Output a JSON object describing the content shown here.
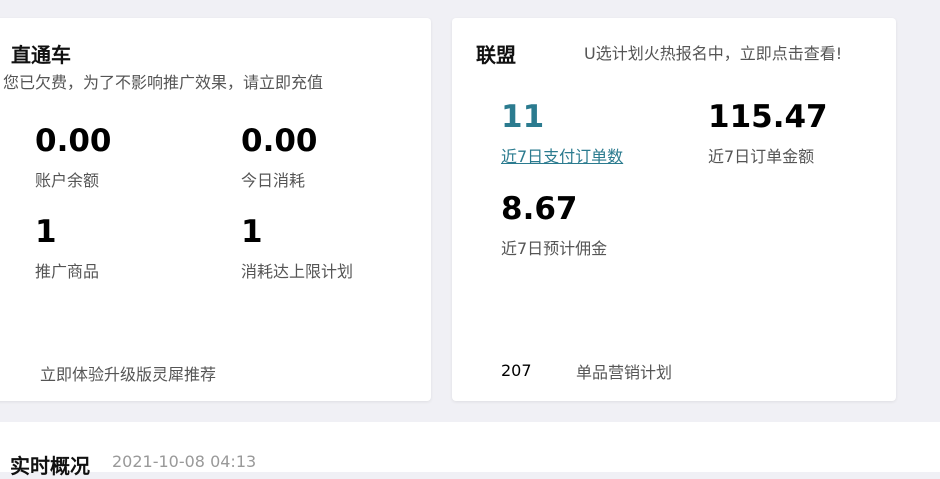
{
  "ztc": {
    "title": "直通车",
    "warning": "您已欠费，为了不影响推广效果，请立即充值",
    "stats": [
      {
        "value": "0.00",
        "label": "账户余额"
      },
      {
        "value": "0.00",
        "label": "今日消耗"
      },
      {
        "value": "1",
        "label": "推广商品"
      },
      {
        "value": "1",
        "label": "消耗达上限计划"
      }
    ],
    "upgrade_link": "立即体验升级版灵犀推荐"
  },
  "alliance": {
    "title": "联盟",
    "promo": "U选计划火热报名中，立即点击查看!",
    "stats": [
      {
        "value": "11",
        "label": "近7日支付订单数"
      },
      {
        "value": "115.47",
        "label": "近7日订单金额"
      },
      {
        "value": "8.67",
        "label": "近7日预计佣金"
      }
    ],
    "footer_count": "207",
    "footer_label": "单品营销计划"
  },
  "realtime": {
    "title": "实时概况",
    "timestamp": "2021-10-08 04:13"
  },
  "colors": {
    "link": "#2b7b8f",
    "background": "#f0f0f5"
  }
}
